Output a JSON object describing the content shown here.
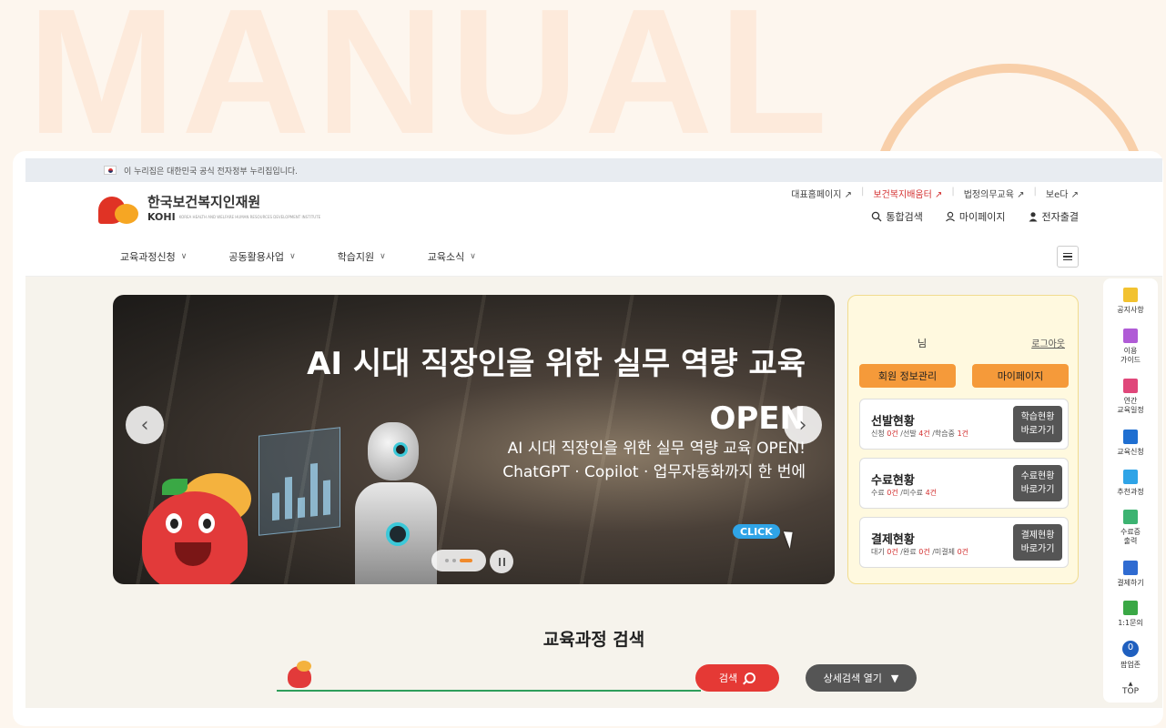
{
  "background": {
    "watermark": "MANUAL"
  },
  "gov_bar": {
    "text": "이 누리집은 대한민국 공식 전자정부 누리집입니다."
  },
  "header": {
    "org_name_ko": "한국보건복지인재원",
    "org_name_en": "KOHI",
    "org_name_en_small": "KOREA HEALTH AND WELFARE HUMAN RESOURCES DEVELOPMENT INSTITUTE",
    "top_links": [
      "대표홈페이지 ↗",
      "보건복지배움터 ↗",
      "법정의무교육 ↗",
      "보e다 ↗"
    ],
    "utility": [
      {
        "icon": "search-icon",
        "label": "통합검색"
      },
      {
        "icon": "user-icon",
        "label": "마이페이지"
      },
      {
        "icon": "person-icon",
        "label": "전자출결"
      }
    ]
  },
  "nav": {
    "items": [
      "교육과정신청",
      "공동활용사업",
      "학습지원",
      "교육소식"
    ]
  },
  "banner": {
    "title_line1": "AI 시대 직장인을 위한 실무 역량 교육",
    "title_line2": "OPEN",
    "sub_line1": "AI 시대 직장인을 위한 실무 역량 교육 OPEN!",
    "sub_line2": "ChatGPT · Copilot · 업무자동화까지 한 번에",
    "click_label": "CLICK",
    "prev": "‹",
    "next": "›"
  },
  "user_panel": {
    "user_suffix": "님",
    "logout": "로그아웃",
    "btn_profile": "회원 정보관리",
    "btn_mypage": "마이페이지",
    "cards": [
      {
        "title": "선발현황",
        "parts": [
          "신청 ",
          "0건",
          " /선발 ",
          "4건",
          " /학습중 ",
          "1건"
        ],
        "button_line1": "학습현황",
        "button_line2": "바로가기"
      },
      {
        "title": "수료현황",
        "parts": [
          "수료 ",
          "0건",
          " /미수료 ",
          "4건",
          "",
          ""
        ],
        "button_line1": "수료현황",
        "button_line2": "바로가기"
      },
      {
        "title": "결제현황",
        "parts": [
          "대기 ",
          "0건",
          " /완료 ",
          "0건",
          " /미결제 ",
          "0건"
        ],
        "button_line1": "결제현황",
        "button_line2": "바로가기"
      }
    ]
  },
  "search": {
    "title": "교육과정 검색",
    "button": "검색",
    "advanced": "상세검색 열기"
  },
  "quick_menu": {
    "items": [
      {
        "label": "공지사항",
        "icon": "notice-icon",
        "color": "#f2c230"
      },
      {
        "label": "이용\n가이드",
        "icon": "guide-icon",
        "color": "#b05bd6"
      },
      {
        "label": "연간\n교육일정",
        "icon": "calendar-icon",
        "color": "#e0477a"
      },
      {
        "label": "교육신청",
        "icon": "apply-icon",
        "color": "#1f6fd1"
      },
      {
        "label": "추천과정",
        "icon": "thumbs-up-icon",
        "color": "#2fa4e7"
      },
      {
        "label": "수료증\n출력",
        "icon": "certificate-icon",
        "color": "#3cb371"
      },
      {
        "label": "결제하기",
        "icon": "payment-icon",
        "color": "#2f6bd1"
      },
      {
        "label": "1:1문의",
        "icon": "inquiry-icon",
        "color": "#3aa845"
      },
      {
        "label": "팝업존",
        "icon": "popup-count-icon",
        "color": "#1f5fbf",
        "count": "0"
      }
    ],
    "top": "TOP",
    "side_tab": "›"
  }
}
